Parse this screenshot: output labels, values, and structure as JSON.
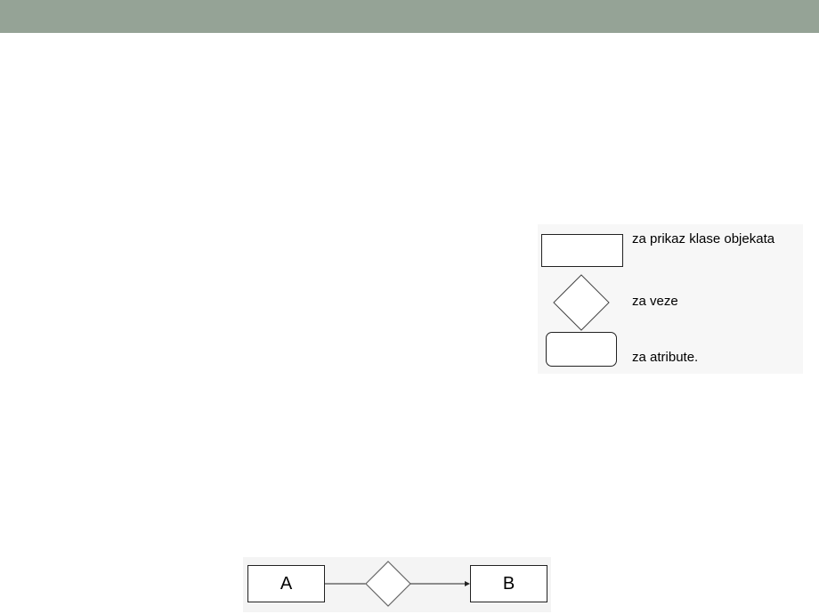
{
  "legend": {
    "items": [
      {
        "shape": "rectangle",
        "label": "za prikaz klase objekata"
      },
      {
        "shape": "diamond",
        "label": "za veze"
      },
      {
        "shape": "rounded-rectangle",
        "label": "za atribute."
      }
    ]
  },
  "diagram": {
    "entity_a": "A",
    "entity_b": "B"
  }
}
